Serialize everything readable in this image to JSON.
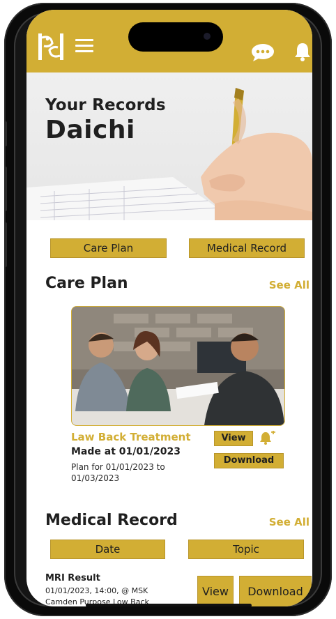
{
  "header": {
    "logo_icon": "logo-icon",
    "menu_icon": "menu-icon",
    "chat_icon": "chat-icon",
    "bell_icon": "bell-icon",
    "accent": "#d2ae34"
  },
  "hero": {
    "title": "Your Records",
    "name": "Daichi"
  },
  "tabs": [
    {
      "label": "Care Plan"
    },
    {
      "label": "Medical Record"
    }
  ],
  "care_plan": {
    "heading": "Care Plan",
    "see_all": "See All",
    "card": {
      "title": "Law Back Treatment",
      "made": "Made at 01/01/2023",
      "plan": "Plan for 01/01/2023 to 01/03/2023",
      "view_label": "View",
      "download_label": "Download",
      "reminder_icon": "bell-plus-icon"
    }
  },
  "medical_record": {
    "heading": "Medical Record",
    "see_all": "See All",
    "columns": [
      "Date",
      "Topic"
    ],
    "rows": [
      {
        "title": "MRI Result",
        "meta_line1": "01/01/2023, 14:00, @ MSK",
        "meta_line2": "Camden Purpose Low Back",
        "view_label": "View",
        "download_label": "Download"
      }
    ]
  }
}
